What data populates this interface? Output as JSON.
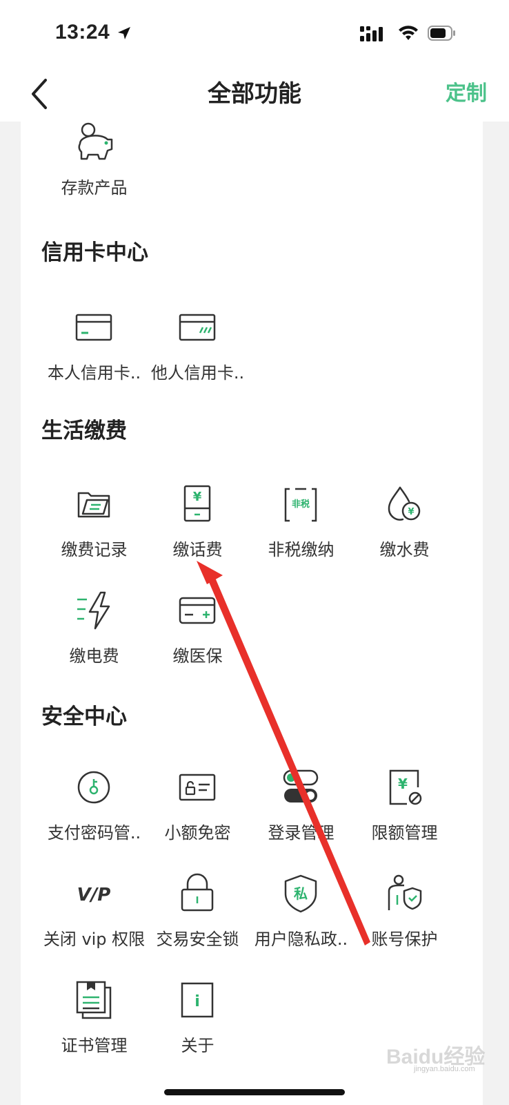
{
  "status_bar": {
    "time": "13:24"
  },
  "nav": {
    "back_icon": "chevron-left-icon",
    "title": "全部功能",
    "action": "定制",
    "accent_color": "#4cc28a"
  },
  "sections": {
    "top": {
      "items": [
        {
          "label": "存款产品",
          "icon": "piggy-bank-icon"
        }
      ]
    },
    "credit": {
      "title": "信用卡中心",
      "items": [
        {
          "label": "本人信用卡..",
          "icon": "credit-card-icon"
        },
        {
          "label": "他人信用卡..",
          "icon": "other-card-icon"
        }
      ]
    },
    "life": {
      "title": "生活缴费",
      "items": [
        {
          "label": "缴费记录",
          "icon": "payment-record-icon"
        },
        {
          "label": "缴话费",
          "icon": "phone-bill-icon"
        },
        {
          "label": "非税缴纳",
          "icon": "non-tax-icon"
        },
        {
          "label": "缴水费",
          "icon": "water-bill-icon"
        },
        {
          "label": "缴电费",
          "icon": "electricity-bill-icon"
        },
        {
          "label": "缴医保",
          "icon": "medical-insurance-icon"
        }
      ],
      "non_tax_glyph": "非税",
      "yuan_glyph": "¥"
    },
    "security": {
      "title": "安全中心",
      "items": [
        {
          "label": "支付密码管..",
          "icon": "key-icon"
        },
        {
          "label": "小额免密",
          "icon": "small-payment-icon"
        },
        {
          "label": "登录管理",
          "icon": "login-toggle-icon"
        },
        {
          "label": "限额管理",
          "icon": "limit-icon"
        },
        {
          "label": "关闭 vip 权限",
          "icon": "vip-icon"
        },
        {
          "label": "交易安全锁",
          "icon": "lock-icon"
        },
        {
          "label": "用户隐私政..",
          "icon": "privacy-shield-icon"
        },
        {
          "label": "账号保护",
          "icon": "account-protect-icon"
        },
        {
          "label": "证书管理",
          "icon": "certificate-icon"
        },
        {
          "label": "关于",
          "icon": "info-icon"
        }
      ],
      "vip_glyph": "V/P",
      "privacy_glyph": "私",
      "info_glyph": "i"
    }
  },
  "watermark": {
    "main": "Baidu经验",
    "sub": "jingyan.baidu.com"
  },
  "annotation_color": "#e8302a"
}
